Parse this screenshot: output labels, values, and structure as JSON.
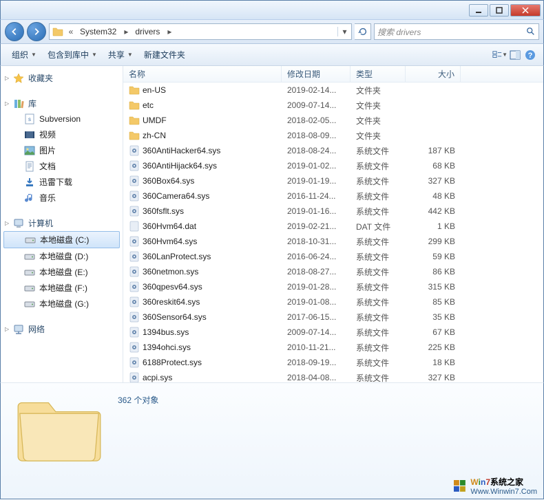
{
  "titlebar": {},
  "address": {
    "segments": [
      "System32",
      "drivers"
    ],
    "search_placeholder": "搜索 drivers"
  },
  "toolbar": {
    "organize": "组织",
    "include": "包含到库中",
    "share": "共享",
    "newfolder": "新建文件夹"
  },
  "sidebar": {
    "favorites": {
      "label": "收藏夹"
    },
    "libraries": {
      "label": "库",
      "items": [
        {
          "label": "Subversion",
          "icon": "subversion"
        },
        {
          "label": "视频",
          "icon": "video"
        },
        {
          "label": "图片",
          "icon": "picture"
        },
        {
          "label": "文档",
          "icon": "document"
        },
        {
          "label": "迅雷下载",
          "icon": "download"
        },
        {
          "label": "音乐",
          "icon": "music"
        }
      ]
    },
    "computer": {
      "label": "计算机",
      "items": [
        {
          "label": "本地磁盘 (C:)",
          "selected": true
        },
        {
          "label": "本地磁盘 (D:)"
        },
        {
          "label": "本地磁盘 (E:)"
        },
        {
          "label": "本地磁盘 (F:)"
        },
        {
          "label": "本地磁盘 (G:)"
        }
      ]
    },
    "network": {
      "label": "网络"
    }
  },
  "columns": {
    "name": "名称",
    "date": "修改日期",
    "type": "类型",
    "size": "大小"
  },
  "files": [
    {
      "name": "en-US",
      "date": "2019-02-14...",
      "type": "文件夹",
      "size": "",
      "icon": "folder"
    },
    {
      "name": "etc",
      "date": "2009-07-14...",
      "type": "文件夹",
      "size": "",
      "icon": "folder"
    },
    {
      "name": "UMDF",
      "date": "2018-02-05...",
      "type": "文件夹",
      "size": "",
      "icon": "folder"
    },
    {
      "name": "zh-CN",
      "date": "2018-08-09...",
      "type": "文件夹",
      "size": "",
      "icon": "folder"
    },
    {
      "name": "360AntiHacker64.sys",
      "date": "2018-08-24...",
      "type": "系统文件",
      "size": "187 KB",
      "icon": "sys"
    },
    {
      "name": "360AntiHijack64.sys",
      "date": "2019-01-02...",
      "type": "系统文件",
      "size": "68 KB",
      "icon": "sys"
    },
    {
      "name": "360Box64.sys",
      "date": "2019-01-19...",
      "type": "系统文件",
      "size": "327 KB",
      "icon": "sys"
    },
    {
      "name": "360Camera64.sys",
      "date": "2016-11-24...",
      "type": "系统文件",
      "size": "48 KB",
      "icon": "sys"
    },
    {
      "name": "360fsflt.sys",
      "date": "2019-01-16...",
      "type": "系统文件",
      "size": "442 KB",
      "icon": "sys"
    },
    {
      "name": "360Hvm64.dat",
      "date": "2019-02-21...",
      "type": "DAT 文件",
      "size": "1 KB",
      "icon": "dat"
    },
    {
      "name": "360Hvm64.sys",
      "date": "2018-10-31...",
      "type": "系统文件",
      "size": "299 KB",
      "icon": "sys"
    },
    {
      "name": "360LanProtect.sys",
      "date": "2016-06-24...",
      "type": "系统文件",
      "size": "59 KB",
      "icon": "sys"
    },
    {
      "name": "360netmon.sys",
      "date": "2018-08-27...",
      "type": "系统文件",
      "size": "86 KB",
      "icon": "sys"
    },
    {
      "name": "360qpesv64.sys",
      "date": "2019-01-28...",
      "type": "系统文件",
      "size": "315 KB",
      "icon": "sys"
    },
    {
      "name": "360reskit64.sys",
      "date": "2019-01-08...",
      "type": "系统文件",
      "size": "85 KB",
      "icon": "sys"
    },
    {
      "name": "360Sensor64.sys",
      "date": "2017-06-15...",
      "type": "系统文件",
      "size": "35 KB",
      "icon": "sys"
    },
    {
      "name": "1394bus.sys",
      "date": "2009-07-14...",
      "type": "系统文件",
      "size": "67 KB",
      "icon": "sys"
    },
    {
      "name": "1394ohci.sys",
      "date": "2010-11-21...",
      "type": "系统文件",
      "size": "225 KB",
      "icon": "sys"
    },
    {
      "name": "6188Protect.sys",
      "date": "2018-09-19...",
      "type": "系统文件",
      "size": "18 KB",
      "icon": "sys"
    },
    {
      "name": "acpi.sys",
      "date": "2018-04-08...",
      "type": "系统文件",
      "size": "327 KB",
      "icon": "sys"
    }
  ],
  "details": {
    "count_label": "362 个对象"
  },
  "watermark": {
    "brand": "Win7系统之家",
    "url": "Www.Winwin7.Com"
  }
}
